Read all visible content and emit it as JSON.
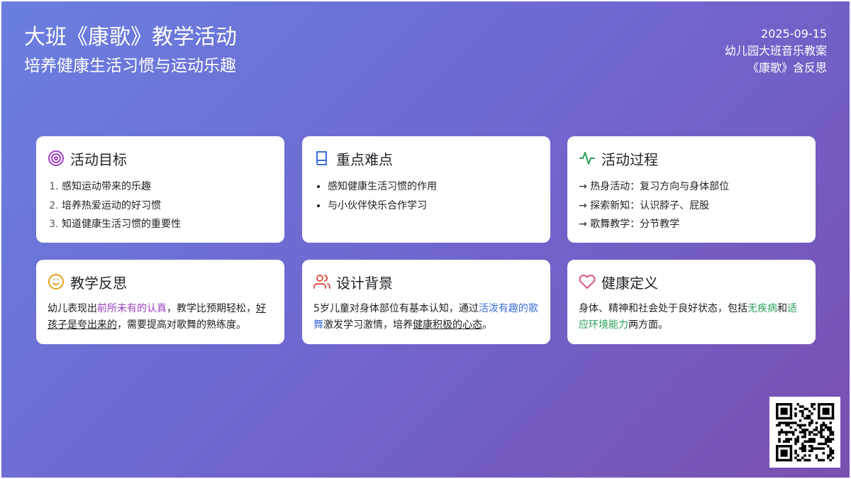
{
  "header": {
    "title": "大班《康歌》教学活动",
    "subtitle": "培养健康生活习惯与运动乐趣",
    "date": "2025-09-15",
    "category": "幼儿园大班音乐教案",
    "doc_name": "《康歌》含反思"
  },
  "cards": {
    "goals": {
      "title": "活动目标",
      "icon": "target-icon",
      "items": [
        "感知运动带来的乐趣",
        "培养热爱运动的好习惯",
        "知道健康生活习惯的重要性"
      ]
    },
    "keypoints": {
      "title": "重点难点",
      "icon": "book-icon",
      "items": [
        "感知健康生活习惯的作用",
        "与小伙伴快乐合作学习"
      ]
    },
    "process": {
      "title": "活动过程",
      "icon": "activity-pulse-icon",
      "items": [
        "→ 热身活动：复习方向与身体部位",
        "→ 探索新知：认识脖子、屁股",
        "→ 歌舞教学：分节教学"
      ]
    },
    "reflection": {
      "title": "教学反思",
      "icon": "smile-icon",
      "p1": "幼儿表现出",
      "h1": "前所未有的认真",
      "p2": "，教学比预期轻松，",
      "h2": "好孩子是夸出来的",
      "p3": "，需要提高对歌舞的熟练度。"
    },
    "background": {
      "title": "设计背景",
      "icon": "users-icon",
      "p1": "5岁儿童对身体部位有基本认知，通过",
      "h1": "活泼有趣的歌舞",
      "p2": "激发学习激情，培养",
      "h2": "健康积极的心态",
      "p3": "。"
    },
    "health": {
      "title": "健康定义",
      "icon": "heart-icon",
      "p1": "身体、精神和社会处于良好状态，包括",
      "h1": "无疾病",
      "p2": "和",
      "h2": "适应环境能力",
      "p3": "两方面。"
    }
  },
  "colors": {
    "accent_purple": "#9b3fc2",
    "accent_blue": "#3b6fd6",
    "accent_green": "#2aa05a",
    "heart_pink": "#d9548a",
    "users_red": "#e0554a",
    "smile_yellow": "#e0a51a"
  }
}
